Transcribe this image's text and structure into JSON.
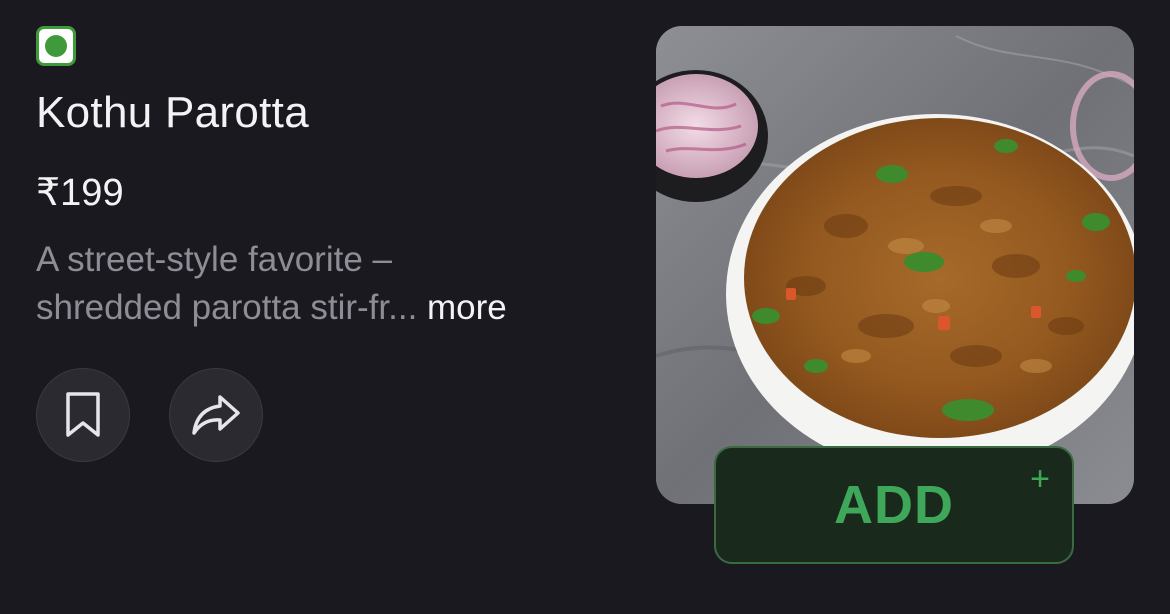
{
  "item": {
    "name": "Kothu Parotta",
    "price": "₹199",
    "description_line1": "A street-style favorite –",
    "description_line2": "shredded parotta stir-fr...",
    "more_label": "more",
    "veg_indicator_icon": "veg-dot-icon"
  },
  "actions": {
    "bookmark_icon": "bookmark-icon",
    "share_icon": "share-arrow-icon",
    "add_label": "ADD",
    "add_plus": "+"
  },
  "colors": {
    "background": "#1a1920",
    "veg_green": "#3f9a3c",
    "add_green": "#3fa75a",
    "add_button_bg": "#19291c"
  }
}
